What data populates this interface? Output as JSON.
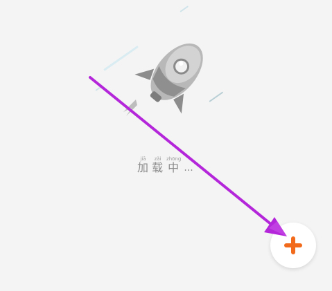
{
  "loading": {
    "characters": [
      {
        "pinyin": "jiā",
        "hanzi": "加"
      },
      {
        "pinyin": "zǎi",
        "hanzi": "载"
      },
      {
        "pinyin": "zhōng",
        "hanzi": "中"
      }
    ],
    "ellipsis": "..."
  },
  "fab": {
    "icon": "plus-icon",
    "color": "#f26a1b"
  },
  "annotation": {
    "arrow_color": "#b426d9"
  },
  "illustration": {
    "icon": "rocket-icon",
    "body_color": "#9e9e9e",
    "speed_line_color": "#cfe3ea"
  }
}
